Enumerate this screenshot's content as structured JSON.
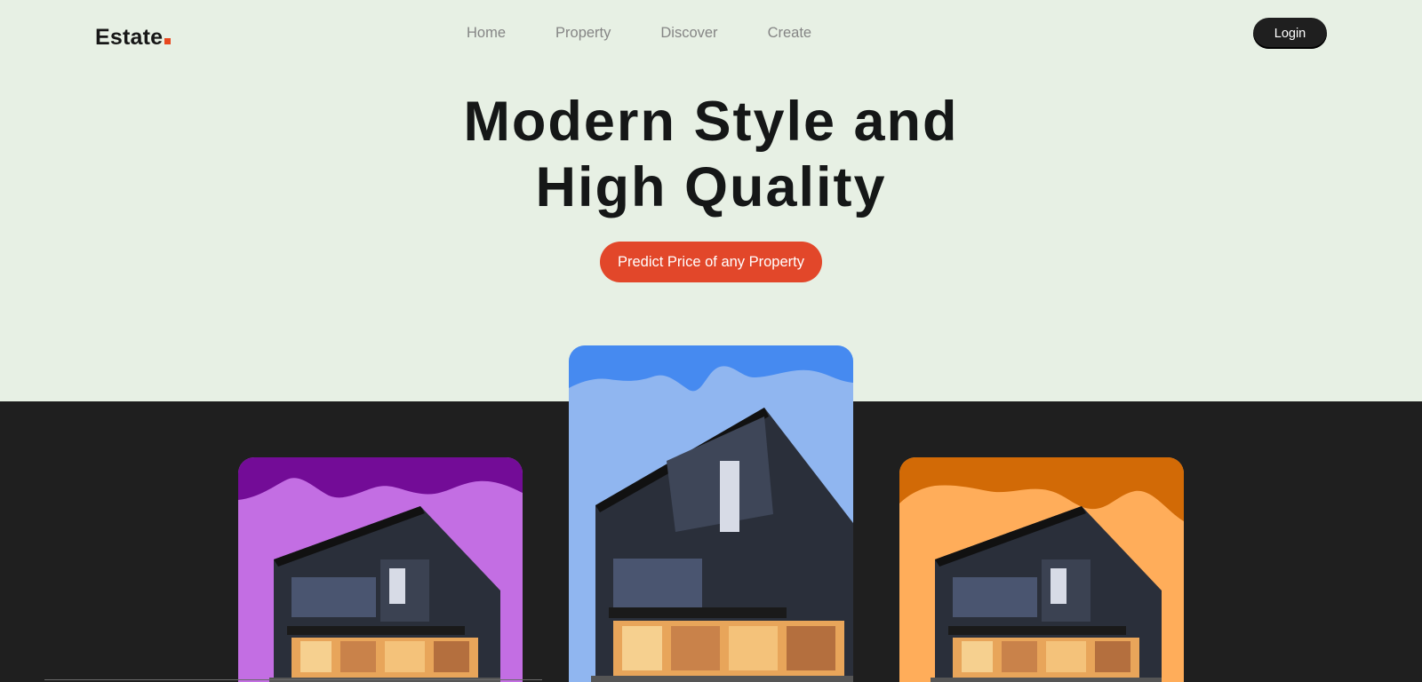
{
  "nav": {
    "logo": "Estate",
    "links": [
      "Home",
      "Property",
      "Discover",
      "Create"
    ],
    "login_label": "Login"
  },
  "hero": {
    "title_line1": "Modern Style and",
    "title_line2": "High Quality",
    "cta_label": "Predict Price of any Property"
  },
  "colors": {
    "background": "#e7f0e4",
    "dark_band": "#1f1f1f",
    "accent": "#e2472a",
    "card_purple_top": "#730c97",
    "card_purple": "#c36ee3",
    "card_blue_top": "#468af0",
    "card_blue": "#90b6f0",
    "card_orange_top": "#d26a06",
    "card_orange": "#ffad5a"
  },
  "cards": [
    {
      "name": "purple-house-card",
      "icon": "house-image"
    },
    {
      "name": "blue-house-card",
      "icon": "house-image"
    },
    {
      "name": "orange-house-card",
      "icon": "house-image"
    }
  ]
}
